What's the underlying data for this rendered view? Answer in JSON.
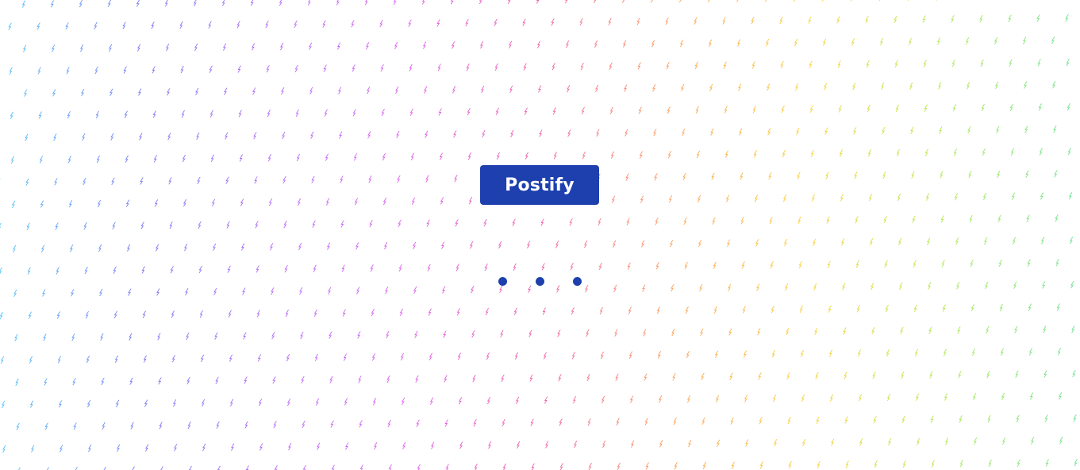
{
  "app": {
    "logo_text": "Postify"
  },
  "loading_indicator": {
    "dot_count": 3
  },
  "colors": {
    "brand": "#1e40af",
    "background": "#ffffff",
    "pattern_palette": [
      "#38bdf8",
      "#6366f1",
      "#a855f7",
      "#d946ef",
      "#ec4899",
      "#fb923c",
      "#facc15",
      "#a3e635",
      "#4ade80"
    ]
  },
  "background_pattern": {
    "glyph": "lightning-bolt-icon"
  }
}
